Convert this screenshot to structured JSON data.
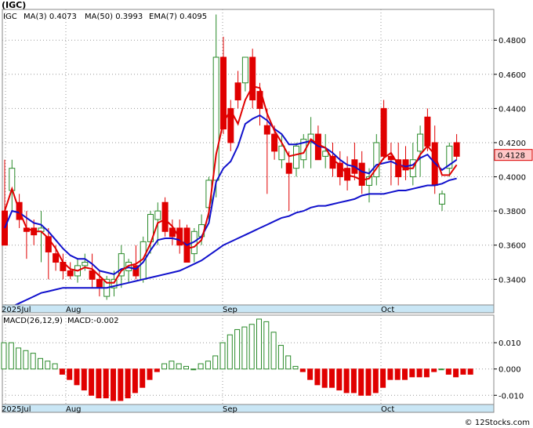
{
  "chart_data": [
    {
      "type": "candlestick",
      "ticker": "(IGC)",
      "ylim": [
        0.325,
        0.498
      ],
      "yticks": [
        "0.3400",
        "0.3600",
        "0.3800",
        "0.4000",
        "0.4200",
        "0.4400",
        "0.4600",
        "0.4800"
      ],
      "x_labels": [
        "2025Jul",
        "Aug",
        "Sep",
        "Oct"
      ],
      "last_price_label": "0.4128",
      "legend": [
        {
          "text": "MA(3)",
          "value": "0.4073",
          "color": "#e00000"
        },
        {
          "text": "MA(50)",
          "value": "0.3993",
          "color": "#1010cc"
        },
        {
          "text": "EMA(7)",
          "value": "0.4095",
          "color": "#1010cc"
        }
      ],
      "candles": [
        [
          0.38,
          0.41,
          0.36,
          0.36
        ],
        [
          0.392,
          0.41,
          0.38,
          0.405
        ],
        [
          0.385,
          0.39,
          0.37,
          0.375
        ],
        [
          0.37,
          0.38,
          0.352,
          0.368
        ],
        [
          0.37,
          0.375,
          0.36,
          0.366
        ],
        [
          0.368,
          0.38,
          0.35,
          0.37
        ],
        [
          0.365,
          0.37,
          0.34,
          0.356
        ],
        [
          0.355,
          0.36,
          0.345,
          0.35
        ],
        [
          0.35,
          0.355,
          0.34,
          0.345
        ],
        [
          0.345,
          0.35,
          0.34,
          0.342
        ],
        [
          0.342,
          0.352,
          0.338,
          0.348
        ],
        [
          0.348,
          0.355,
          0.345,
          0.35
        ],
        [
          0.345,
          0.355,
          0.335,
          0.34
        ],
        [
          0.34,
          0.345,
          0.33,
          0.335
        ],
        [
          0.33,
          0.342,
          0.328,
          0.34
        ],
        [
          0.335,
          0.345,
          0.33,
          0.34
        ],
        [
          0.342,
          0.36,
          0.335,
          0.355
        ],
        [
          0.345,
          0.352,
          0.338,
          0.35
        ],
        [
          0.348,
          0.36,
          0.34,
          0.342
        ],
        [
          0.34,
          0.365,
          0.338,
          0.362
        ],
        [
          0.362,
          0.38,
          0.355,
          0.378
        ],
        [
          0.375,
          0.385,
          0.36,
          0.38
        ],
        [
          0.385,
          0.388,
          0.365,
          0.368
        ],
        [
          0.37,
          0.375,
          0.36,
          0.365
        ],
        [
          0.37,
          0.375,
          0.355,
          0.36
        ],
        [
          0.37,
          0.372,
          0.35,
          0.35
        ],
        [
          0.355,
          0.37,
          0.35,
          0.368
        ],
        [
          0.365,
          0.378,
          0.36,
          0.372
        ],
        [
          0.382,
          0.4,
          0.375,
          0.398
        ],
        [
          0.398,
          0.495,
          0.388,
          0.47
        ],
        [
          0.47,
          0.482,
          0.425,
          0.428
        ],
        [
          0.44,
          0.445,
          0.415,
          0.42
        ],
        [
          0.455,
          0.462,
          0.44,
          0.445
        ],
        [
          0.455,
          0.47,
          0.45,
          0.47
        ],
        [
          0.47,
          0.475,
          0.44,
          0.445
        ],
        [
          0.45,
          0.455,
          0.43,
          0.44
        ],
        [
          0.43,
          0.44,
          0.39,
          0.425
        ],
        [
          0.425,
          0.43,
          0.41,
          0.415
        ],
        [
          0.41,
          0.425,
          0.405,
          0.418
        ],
        [
          0.408,
          0.415,
          0.38,
          0.402
        ],
        [
          0.405,
          0.42,
          0.4,
          0.418
        ],
        [
          0.41,
          0.425,
          0.405,
          0.422
        ],
        [
          0.42,
          0.435,
          0.405,
          0.425
        ],
        [
          0.425,
          0.43,
          0.41,
          0.41
        ],
        [
          0.412,
          0.425,
          0.405,
          0.415
        ],
        [
          0.412,
          0.42,
          0.4,
          0.405
        ],
        [
          0.408,
          0.415,
          0.395,
          0.4
        ],
        [
          0.405,
          0.412,
          0.392,
          0.398
        ],
        [
          0.41,
          0.42,
          0.398,
          0.402
        ],
        [
          0.408,
          0.415,
          0.39,
          0.395
        ],
        [
          0.395,
          0.405,
          0.385,
          0.4
        ],
        [
          0.4,
          0.425,
          0.395,
          0.42
        ],
        [
          0.44,
          0.445,
          0.41,
          0.412
        ],
        [
          0.412,
          0.42,
          0.395,
          0.41
        ],
        [
          0.41,
          0.42,
          0.395,
          0.4
        ],
        [
          0.41,
          0.418,
          0.398,
          0.404
        ],
        [
          0.4,
          0.42,
          0.395,
          0.41
        ],
        [
          0.415,
          0.43,
          0.4,
          0.425
        ],
        [
          0.435,
          0.44,
          0.415,
          0.418
        ],
        [
          0.42,
          0.43,
          0.39,
          0.395
        ],
        [
          0.384,
          0.392,
          0.38,
          0.39
        ],
        [
          0.405,
          0.42,
          0.4,
          0.418
        ],
        [
          0.42,
          0.425,
          0.41,
          0.412
        ]
      ],
      "ma3": [
        0.38,
        0.393,
        0.38,
        0.37,
        0.368,
        0.368,
        0.364,
        0.358,
        0.35,
        0.346,
        0.345,
        0.347,
        0.346,
        0.342,
        0.338,
        0.338,
        0.345,
        0.348,
        0.349,
        0.352,
        0.361,
        0.373,
        0.375,
        0.371,
        0.364,
        0.358,
        0.359,
        0.363,
        0.379,
        0.413,
        0.432,
        0.439,
        0.431,
        0.445,
        0.453,
        0.452,
        0.437,
        0.427,
        0.42,
        0.412,
        0.413,
        0.414,
        0.422,
        0.419,
        0.417,
        0.41,
        0.407,
        0.401,
        0.4,
        0.398,
        0.399,
        0.405,
        0.411,
        0.414,
        0.407,
        0.405,
        0.405,
        0.413,
        0.418,
        0.413,
        0.401,
        0.401,
        0.407
      ],
      "ema7": [
        0.37,
        0.38,
        0.379,
        0.376,
        0.373,
        0.372,
        0.368,
        0.363,
        0.358,
        0.354,
        0.352,
        0.352,
        0.349,
        0.345,
        0.344,
        0.343,
        0.346,
        0.347,
        0.346,
        0.35,
        0.357,
        0.363,
        0.364,
        0.364,
        0.363,
        0.36,
        0.362,
        0.365,
        0.373,
        0.397,
        0.405,
        0.409,
        0.418,
        0.431,
        0.434,
        0.436,
        0.433,
        0.428,
        0.425,
        0.419,
        0.419,
        0.42,
        0.421,
        0.418,
        0.417,
        0.414,
        0.41,
        0.407,
        0.406,
        0.403,
        0.402,
        0.407,
        0.408,
        0.409,
        0.407,
        0.406,
        0.407,
        0.411,
        0.413,
        0.408,
        0.404,
        0.407,
        0.41
      ],
      "ma50": [
        0.322,
        0.324,
        0.326,
        0.328,
        0.33,
        0.332,
        0.333,
        0.334,
        0.335,
        0.335,
        0.335,
        0.335,
        0.335,
        0.335,
        0.335,
        0.336,
        0.337,
        0.338,
        0.339,
        0.34,
        0.341,
        0.342,
        0.343,
        0.344,
        0.345,
        0.347,
        0.349,
        0.351,
        0.354,
        0.357,
        0.36,
        0.362,
        0.364,
        0.366,
        0.368,
        0.37,
        0.372,
        0.374,
        0.376,
        0.377,
        0.379,
        0.38,
        0.382,
        0.383,
        0.383,
        0.384,
        0.385,
        0.386,
        0.387,
        0.389,
        0.39,
        0.39,
        0.39,
        0.391,
        0.392,
        0.392,
        0.393,
        0.394,
        0.395,
        0.395,
        0.396,
        0.398,
        0.399
      ]
    },
    {
      "type": "bar",
      "title": "MACD(26,12,9)",
      "value_label": "MACD:-0.002",
      "ylim": [
        -0.0135,
        0.0205
      ],
      "yticks": [
        "0.010",
        "0.000",
        "-0.010"
      ],
      "x_labels": [
        "2025Jul",
        "Aug",
        "Sep",
        "Oct"
      ],
      "values": [
        0.01,
        0.01,
        0.008,
        0.007,
        0.006,
        0.004,
        0.003,
        0.002,
        -0.002,
        -0.004,
        -0.006,
        -0.008,
        -0.01,
        -0.011,
        -0.011,
        -0.012,
        -0.012,
        -0.011,
        -0.009,
        -0.007,
        -0.004,
        -0.001,
        0.002,
        0.003,
        0.002,
        0.001,
        0.0,
        0.002,
        0.003,
        0.005,
        0.01,
        0.013,
        0.015,
        0.016,
        0.017,
        0.019,
        0.018,
        0.014,
        0.009,
        0.005,
        0.001,
        -0.001,
        -0.004,
        -0.006,
        -0.007,
        -0.007,
        -0.008,
        -0.009,
        -0.009,
        -0.01,
        -0.01,
        -0.009,
        -0.007,
        -0.004,
        -0.004,
        -0.004,
        -0.003,
        -0.003,
        -0.003,
        -0.001,
        0.0,
        -0.002,
        -0.003,
        -0.002,
        -0.002
      ]
    }
  ],
  "colors": {
    "up": "#2a8a2a",
    "down": "#e00000",
    "ema": "#1010cc",
    "ma3": "#e00000",
    "grid": "#999999",
    "axis_band": "#c9e6f5",
    "price_tag": "#ffc7c7"
  },
  "footer": "© 12Stocks.com"
}
